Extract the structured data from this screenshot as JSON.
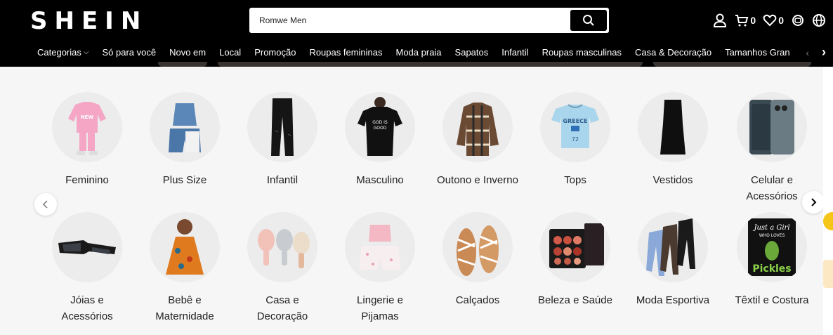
{
  "header": {
    "logo": "SHEIN",
    "search_value": "Romwe Men",
    "cart_count": "0",
    "wishlist_count": "0"
  },
  "nav": {
    "items": [
      {
        "label": "Categorias",
        "has_chevron": true
      },
      {
        "label": "Só para você"
      },
      {
        "label": "Novo em"
      },
      {
        "label": "Local"
      },
      {
        "label": "Promoção"
      },
      {
        "label": "Roupas femininas"
      },
      {
        "label": "Moda praia"
      },
      {
        "label": "Sapatos"
      },
      {
        "label": "Infantil"
      },
      {
        "label": "Roupas masculinas"
      },
      {
        "label": "Casa & Decoração"
      },
      {
        "label": "Tamanhos Gran"
      }
    ]
  },
  "categories": {
    "row1": [
      {
        "label": "Feminino",
        "icon": "pink-hoodie-icon"
      },
      {
        "label": "Plus Size",
        "icon": "denim-set-icon"
      },
      {
        "label": "Infantil",
        "icon": "black-jeans-icon"
      },
      {
        "label": "Masculino",
        "icon": "black-tshirt-icon"
      },
      {
        "label": "Outono e Inverno",
        "icon": "plaid-jacket-icon"
      },
      {
        "label": "Tops",
        "icon": "blue-crop-top-icon"
      },
      {
        "label": "Vestidos",
        "icon": "black-dress-icon"
      },
      {
        "label": "Celular e Acessórios",
        "icon": "phone-icon"
      }
    ],
    "row2": [
      {
        "label": "Jóias e Acessórios",
        "icon": "sunglasses-icon"
      },
      {
        "label": "Bebê e Maternidade",
        "icon": "baby-dress-icon"
      },
      {
        "label": "Casa e Decoração",
        "icon": "kitchen-tools-icon"
      },
      {
        "label": "Lingerie e Pijamas",
        "icon": "pajama-set-icon"
      },
      {
        "label": "Calçados",
        "icon": "sandals-icon"
      },
      {
        "label": "Beleza e Saúde",
        "icon": "eyeshadow-palette-icon"
      },
      {
        "label": "Moda Esportiva",
        "icon": "leggings-icon"
      },
      {
        "label": "Têxtil e Costura",
        "icon": "pickles-blanket-icon"
      }
    ],
    "pickles_text": "Just a Girl WHO LOVES Pickles",
    "tshirt_text": "GREECE",
    "tshirt_number": "72"
  },
  "colors": {
    "header_bg": "#000000",
    "content_bg": "#f6f6f6",
    "accent_yellow": "#f5c518"
  }
}
